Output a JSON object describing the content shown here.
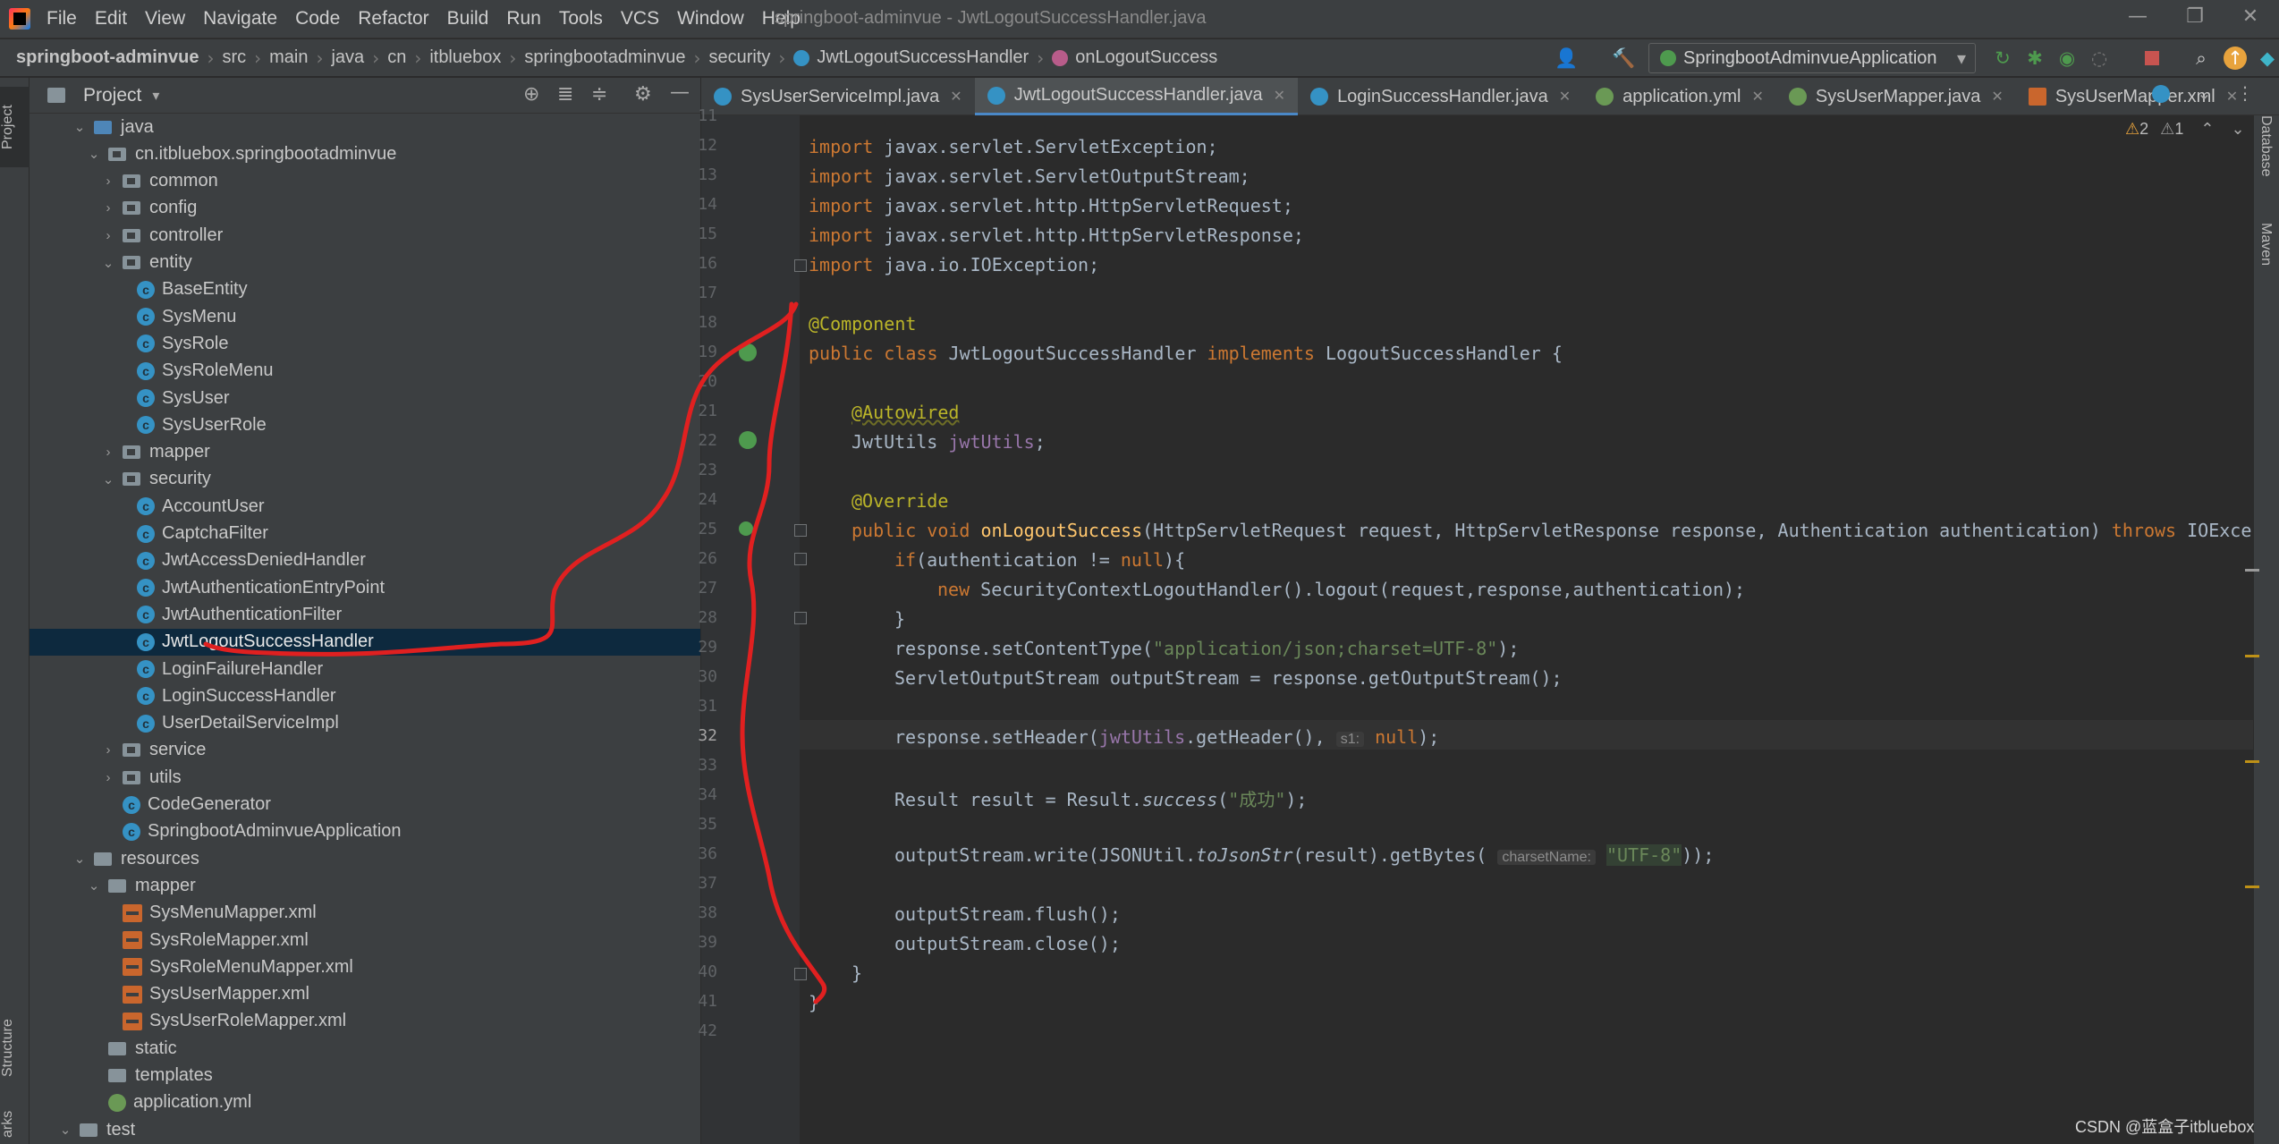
{
  "menu": [
    "File",
    "Edit",
    "View",
    "Navigate",
    "Code",
    "Refactor",
    "Build",
    "Run",
    "Tools",
    "VCS",
    "Window",
    "Help"
  ],
  "window_title": "springboot-adminvue - JwtLogoutSuccessHandler.java",
  "breadcrumb": [
    "springboot-adminvue",
    "src",
    "main",
    "java",
    "cn",
    "itbluebox",
    "springbootadminvue",
    "security",
    "JwtLogoutSuccessHandler",
    "onLogoutSuccess"
  ],
  "run_config": "SpringbootAdminvueApplication",
  "project_panel_title": "Project",
  "tree": [
    {
      "label": "java",
      "depth": 3,
      "icon": "folder-src",
      "chev": "down"
    },
    {
      "label": "cn.itbluebox.springbootadminvue",
      "depth": 4,
      "icon": "folder-pkg",
      "chev": "down"
    },
    {
      "label": "common",
      "depth": 5,
      "icon": "folder-pkg",
      "chev": "right"
    },
    {
      "label": "config",
      "depth": 5,
      "icon": "folder-pkg",
      "chev": "right"
    },
    {
      "label": "controller",
      "depth": 5,
      "icon": "folder-pkg",
      "chev": "right"
    },
    {
      "label": "entity",
      "depth": 5,
      "icon": "folder-pkg",
      "chev": "down"
    },
    {
      "label": "BaseEntity",
      "depth": 6,
      "icon": "class"
    },
    {
      "label": "SysMenu",
      "depth": 6,
      "icon": "class"
    },
    {
      "label": "SysRole",
      "depth": 6,
      "icon": "class"
    },
    {
      "label": "SysRoleMenu",
      "depth": 6,
      "icon": "class"
    },
    {
      "label": "SysUser",
      "depth": 6,
      "icon": "class"
    },
    {
      "label": "SysUserRole",
      "depth": 6,
      "icon": "class"
    },
    {
      "label": "mapper",
      "depth": 5,
      "icon": "folder-pkg",
      "chev": "right"
    },
    {
      "label": "security",
      "depth": 5,
      "icon": "folder-pkg",
      "chev": "down"
    },
    {
      "label": "AccountUser",
      "depth": 6,
      "icon": "class"
    },
    {
      "label": "CaptchaFilter",
      "depth": 6,
      "icon": "class"
    },
    {
      "label": "JwtAccessDeniedHandler",
      "depth": 6,
      "icon": "class"
    },
    {
      "label": "JwtAuthenticationEntryPoint",
      "depth": 6,
      "icon": "class"
    },
    {
      "label": "JwtAuthenticationFilter",
      "depth": 6,
      "icon": "class"
    },
    {
      "label": "JwtLogoutSuccessHandler",
      "depth": 6,
      "icon": "class",
      "selected": true
    },
    {
      "label": "LoginFailureHandler",
      "depth": 6,
      "icon": "class"
    },
    {
      "label": "LoginSuccessHandler",
      "depth": 6,
      "icon": "class"
    },
    {
      "label": "UserDetailServiceImpl",
      "depth": 6,
      "icon": "class"
    },
    {
      "label": "service",
      "depth": 5,
      "icon": "folder-pkg",
      "chev": "right"
    },
    {
      "label": "utils",
      "depth": 5,
      "icon": "folder-pkg",
      "chev": "right"
    },
    {
      "label": "CodeGenerator",
      "depth": 5,
      "icon": "class"
    },
    {
      "label": "SpringbootAdminvueApplication",
      "depth": 5,
      "icon": "class"
    },
    {
      "label": "resources",
      "depth": 3,
      "icon": "folder-res",
      "chev": "down"
    },
    {
      "label": "mapper",
      "depth": 4,
      "icon": "folder",
      "chev": "down"
    },
    {
      "label": "SysMenuMapper.xml",
      "depth": 5,
      "icon": "xml"
    },
    {
      "label": "SysRoleMapper.xml",
      "depth": 5,
      "icon": "xml"
    },
    {
      "label": "SysRoleMenuMapper.xml",
      "depth": 5,
      "icon": "xml"
    },
    {
      "label": "SysUserMapper.xml",
      "depth": 5,
      "icon": "xml"
    },
    {
      "label": "SysUserRoleMapper.xml",
      "depth": 5,
      "icon": "xml"
    },
    {
      "label": "static",
      "depth": 4,
      "icon": "folder"
    },
    {
      "label": "templates",
      "depth": 4,
      "icon": "folder"
    },
    {
      "label": "application.yml",
      "depth": 4,
      "icon": "yml"
    },
    {
      "label": "test",
      "depth": 2,
      "icon": "folder",
      "chev": "down"
    },
    {
      "label": "java",
      "depth": 3,
      "icon": "folder-src",
      "chev": "down"
    }
  ],
  "tabs": [
    {
      "label": "SysUserServiceImpl.java",
      "icon": "c"
    },
    {
      "label": "JwtLogoutSuccessHandler.java",
      "icon": "c",
      "active": true
    },
    {
      "label": "LoginSuccessHandler.java",
      "icon": "c"
    },
    {
      "label": "application.yml",
      "icon": "y"
    },
    {
      "label": "SysUserMapper.java",
      "icon": "i"
    },
    {
      "label": "SysUserMapper.xml",
      "icon": "x"
    }
  ],
  "line_numbers": [
    "11",
    "12",
    "13",
    "14",
    "15",
    "16",
    "17",
    "18",
    "19",
    "20",
    "21",
    "22",
    "23",
    "24",
    "25",
    "26",
    "27",
    "28",
    "29",
    "30",
    "31",
    "32",
    "33",
    "34",
    "35",
    "36",
    "37",
    "38",
    "39",
    "40",
    "41",
    "42"
  ],
  "current_line": "32",
  "code": {
    "l12": "import javax.servlet.ServletException;",
    "l13": "import javax.servlet.ServletOutputStream;",
    "l14": "import javax.servlet.http.HttpServletRequest;",
    "l15": "import javax.servlet.http.HttpServletResponse;",
    "l16": "import java.io.IOException;",
    "l18": "@Component",
    "l19_kw": "public class ",
    "l19_name": "JwtLogoutSuccessHandler ",
    "l19_impl": "implements ",
    "l19_iface": "LogoutSuccessHandler {",
    "l21": "@Autowired",
    "l22_type": "JwtUtils ",
    "l22_field": "jwtUtils",
    "l22_end": ";",
    "l24": "@Override",
    "l25_kw": "public void ",
    "l25_fn": "onLogoutSuccess",
    "l25_params": "(HttpServletRequest request, HttpServletResponse response, Authentication authentication) ",
    "l25_throws": "throws ",
    "l25_exc": "IOExcept",
    "l26_kw": "if",
    "l26_a": "(authentication != ",
    "l26_null": "null",
    "l26_b": "){",
    "l27_kw": "new ",
    "l27_rest": "SecurityContextLogoutHandler().logout(request,response,authentication);",
    "l28": "}",
    "l29_a": "response.setContentType(",
    "l29_str": "\"application/json;charset=UTF-8\"",
    "l29_b": ");",
    "l30": "ServletOutputStream outputStream = response.getOutputStream();",
    "l32_a": "response.setHeader(",
    "l32_field": "jwtUtils",
    "l32_b": ".getHeader(), ",
    "l32_hint": "s1:",
    "l32_null": "null",
    "l32_c": ");",
    "l34_a": "Result result = Result.",
    "l34_it": "success",
    "l34_b": "(",
    "l34_str": "\"成功\"",
    "l34_c": ");",
    "l36_a": "outputStream.write(JSONUtil.",
    "l36_it": "toJsonStr",
    "l36_b": "(result).getBytes( ",
    "l36_hint": "charsetName:",
    "l36_str": "\"UTF-8\"",
    "l36_c": "));",
    "l38": "outputStream.flush();",
    "l39": "outputStream.close();",
    "l40": "}",
    "l41": "}"
  },
  "inspection_counts": {
    "warnings": "2",
    "weak_warnings": "1"
  },
  "side_tabs": {
    "left_top": "Project",
    "left_bottom": "Structure",
    "left_bottom2": "arks",
    "right_top": "Database",
    "right_mid": "Maven"
  },
  "watermark": "CSDN @蓝盒子itbluebox",
  "colors": {
    "accent": "#4a88c7",
    "selection": "#0d293e",
    "annotation_line": "#e02020"
  }
}
